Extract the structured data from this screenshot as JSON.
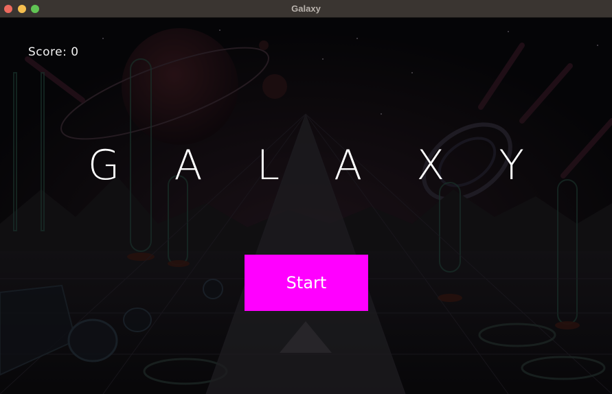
{
  "window": {
    "title": "Galaxy"
  },
  "hud": {
    "score_label": "Score: 0"
  },
  "menu": {
    "title": "G A L A X Y",
    "start_label": "Start"
  },
  "colors": {
    "start_button": "#ff00ff",
    "background": "#0b0b0e",
    "titlebar": "#3a3531"
  }
}
